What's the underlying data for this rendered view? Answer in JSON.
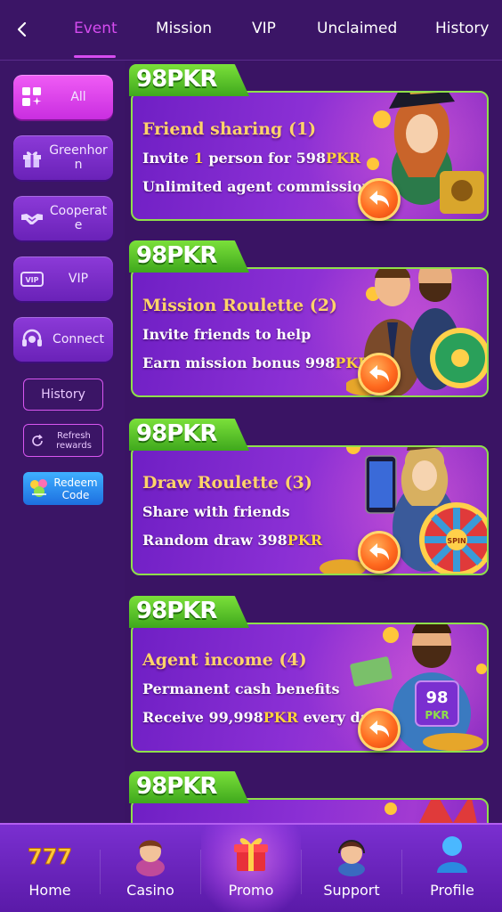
{
  "header": {
    "back_icon": "chevron-left-icon",
    "tabs": [
      {
        "label": "Event",
        "active": true
      },
      {
        "label": "Mission",
        "active": false
      },
      {
        "label": "VIP",
        "active": false
      },
      {
        "label": "Unclaimed",
        "active": false
      },
      {
        "label": "History",
        "active": false
      }
    ]
  },
  "sidebar": {
    "categories": [
      {
        "label": "All",
        "icon": "grid-icon",
        "active": true
      },
      {
        "label": "Greenhorn",
        "icon": "gift-icon",
        "active": false
      },
      {
        "label": "Cooperate",
        "icon": "handshake-icon",
        "active": false
      },
      {
        "label": "VIP",
        "icon": "vip-badge-icon",
        "active": false
      },
      {
        "label": "Connect",
        "icon": "headset-icon",
        "active": false
      }
    ],
    "history_label": "History",
    "refresh_label": "Refresh rewards",
    "redeem_label": "Redeem Code"
  },
  "brand": {
    "logo_number": "98",
    "logo_text": "PKR"
  },
  "promos": [
    {
      "title": "Friend sharing (1)",
      "line1_parts": [
        "Invite ",
        "1",
        " person for 598",
        "PKR"
      ],
      "line2_parts": [
        "Unlimited agent commission"
      ],
      "art": "pirate-woman-illustration"
    },
    {
      "title": "Mission Roulette (2)",
      "line1_parts": [
        "Invite friends to help"
      ],
      "line2_parts": [
        "Earn mission bonus 998",
        "PKR"
      ],
      "art": "businessmen-roulette-illustration"
    },
    {
      "title": "Draw Roulette (3)",
      "line1_parts": [
        "Share with friends"
      ],
      "line2_parts": [
        "Random draw 398",
        "PKR"
      ],
      "art": "spin-wheel-illustration",
      "wheel_text": "SPIN"
    },
    {
      "title": "Agent income (4)",
      "line1_parts": [
        "Permanent cash benefits"
      ],
      "line2_parts": [
        "Receive 99,998",
        "PKR",
        " every day"
      ],
      "art": "man-with-cash-illustration",
      "badge_number": "98",
      "badge_text": "PKR"
    }
  ],
  "bottom_nav": [
    {
      "label": "Home",
      "icon": "slot-777-icon",
      "active": false
    },
    {
      "label": "Casino",
      "icon": "casino-girl-icon",
      "active": false
    },
    {
      "label": "Promo",
      "icon": "gift-box-icon",
      "active": true
    },
    {
      "label": "Support",
      "icon": "support-agent-icon",
      "active": false
    },
    {
      "label": "Profile",
      "icon": "user-profile-icon",
      "active": false
    }
  ],
  "colors": {
    "background": "#3a1464",
    "accent": "#d64cf0",
    "logo_green": "#6ccf2e",
    "highlight_yellow": "#ffd33a",
    "title_gold": "#ffd36a"
  }
}
